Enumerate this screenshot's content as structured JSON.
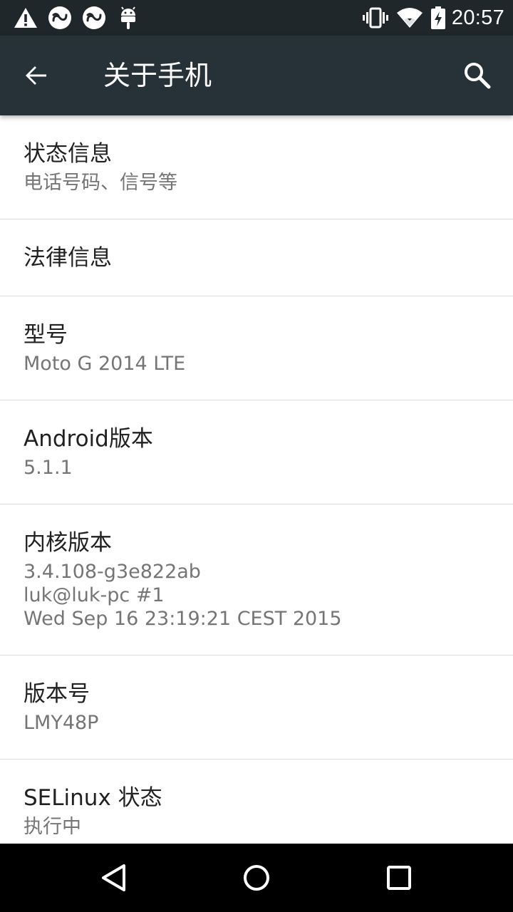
{
  "status_bar": {
    "time": "20:57",
    "left_icons": [
      "warning-icon",
      "infinity-icon",
      "infinity-icon",
      "android-icon"
    ],
    "right_icons": [
      "vibrate-icon",
      "wifi-icon",
      "battery-charging-icon"
    ]
  },
  "app_bar": {
    "title": "关于手机",
    "back_icon": "arrow-back-icon",
    "search_icon": "search-icon",
    "background": "#263238"
  },
  "list": {
    "items": [
      {
        "label": "状态信息",
        "sub": "电话号码、信号等"
      },
      {
        "label": "法律信息"
      },
      {
        "label": "型号",
        "sub": "Moto G 2014 LTE"
      },
      {
        "label": "Android版本",
        "sub": "5.1.1"
      },
      {
        "label": "内核版本",
        "sub_lines": [
          "3.4.108-g3e822ab",
          "luk@luk-pc #1",
          "Wed Sep 16 23:19:21 CEST 2015"
        ]
      },
      {
        "label": "版本号",
        "sub": "LMY48P"
      },
      {
        "label": "SELinux 状态",
        "sub": "执行中"
      }
    ]
  },
  "nav_bar": {
    "icons": [
      "nav-back-icon",
      "nav-home-icon",
      "nav-recents-icon"
    ]
  }
}
